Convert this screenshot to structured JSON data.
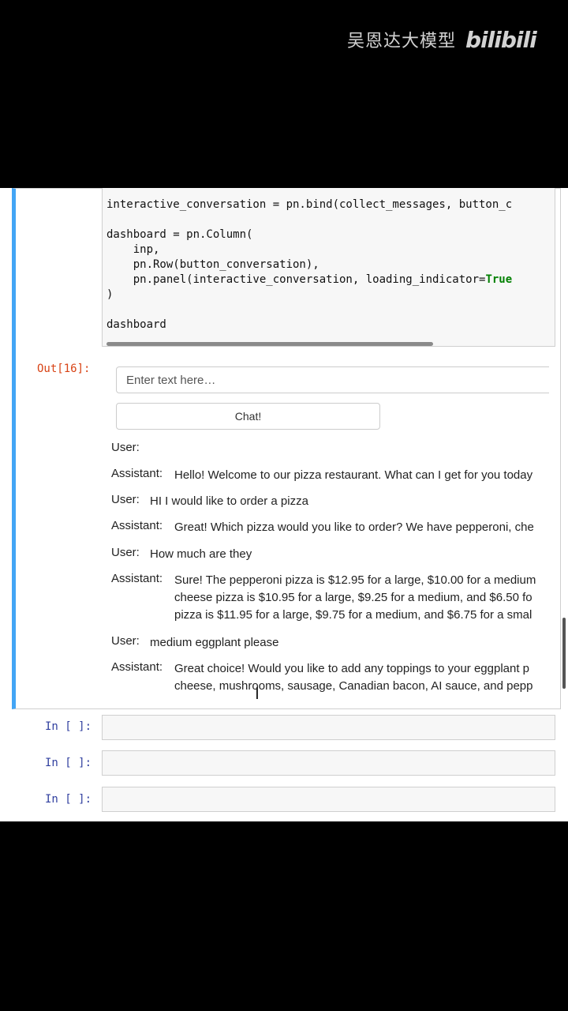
{
  "watermark": {
    "channel": "吴恩达大模型",
    "logo": "bilibili"
  },
  "code_cell": {
    "lines": [
      "interactive_conversation = pn.bind(collect_messages, button_c",
      "",
      "dashboard = pn.Column(",
      "    inp,",
      "    pn.Row(button_conversation),",
      "    pn.panel(interactive_conversation, loading_indicator=",
      ")",
      "",
      "dashboard"
    ],
    "keyword": "True"
  },
  "output_prompt": "Out[16]:",
  "input": {
    "placeholder": "Enter text here…"
  },
  "chat_button": "Chat!",
  "messages": [
    {
      "role": "User:",
      "text": ""
    },
    {
      "role": "Assistant:",
      "text": "Hello! Welcome to our pizza restaurant. What can I get for you today"
    },
    {
      "role": "User:",
      "text": "HI I would like to order a pizza"
    },
    {
      "role": "Assistant:",
      "text": "Great! Which pizza would you like to order? We have pepperoni, che"
    },
    {
      "role": "User:",
      "text": "How much are they"
    },
    {
      "role": "Assistant:",
      "lines": [
        "Sure! The pepperoni pizza is $12.95 for a large, $10.00 for a medium",
        "cheese pizza is $10.95 for a large, $9.25 for a medium, and $6.50 fo",
        "pizza is $11.95 for a large, $9.75 for a medium, and $6.75 for a smal"
      ]
    },
    {
      "role": "User:",
      "text": "medium eggplant please"
    },
    {
      "role": "Assistant:",
      "lines": [
        "Great choice! Would you like to add any toppings to your eggplant p",
        "cheese, mushrooms, sausage, Canadian bacon, AI sauce, and pepp"
      ]
    }
  ],
  "empty_cells": [
    "In [ ]:",
    "In [ ]:",
    "In [ ]:"
  ]
}
